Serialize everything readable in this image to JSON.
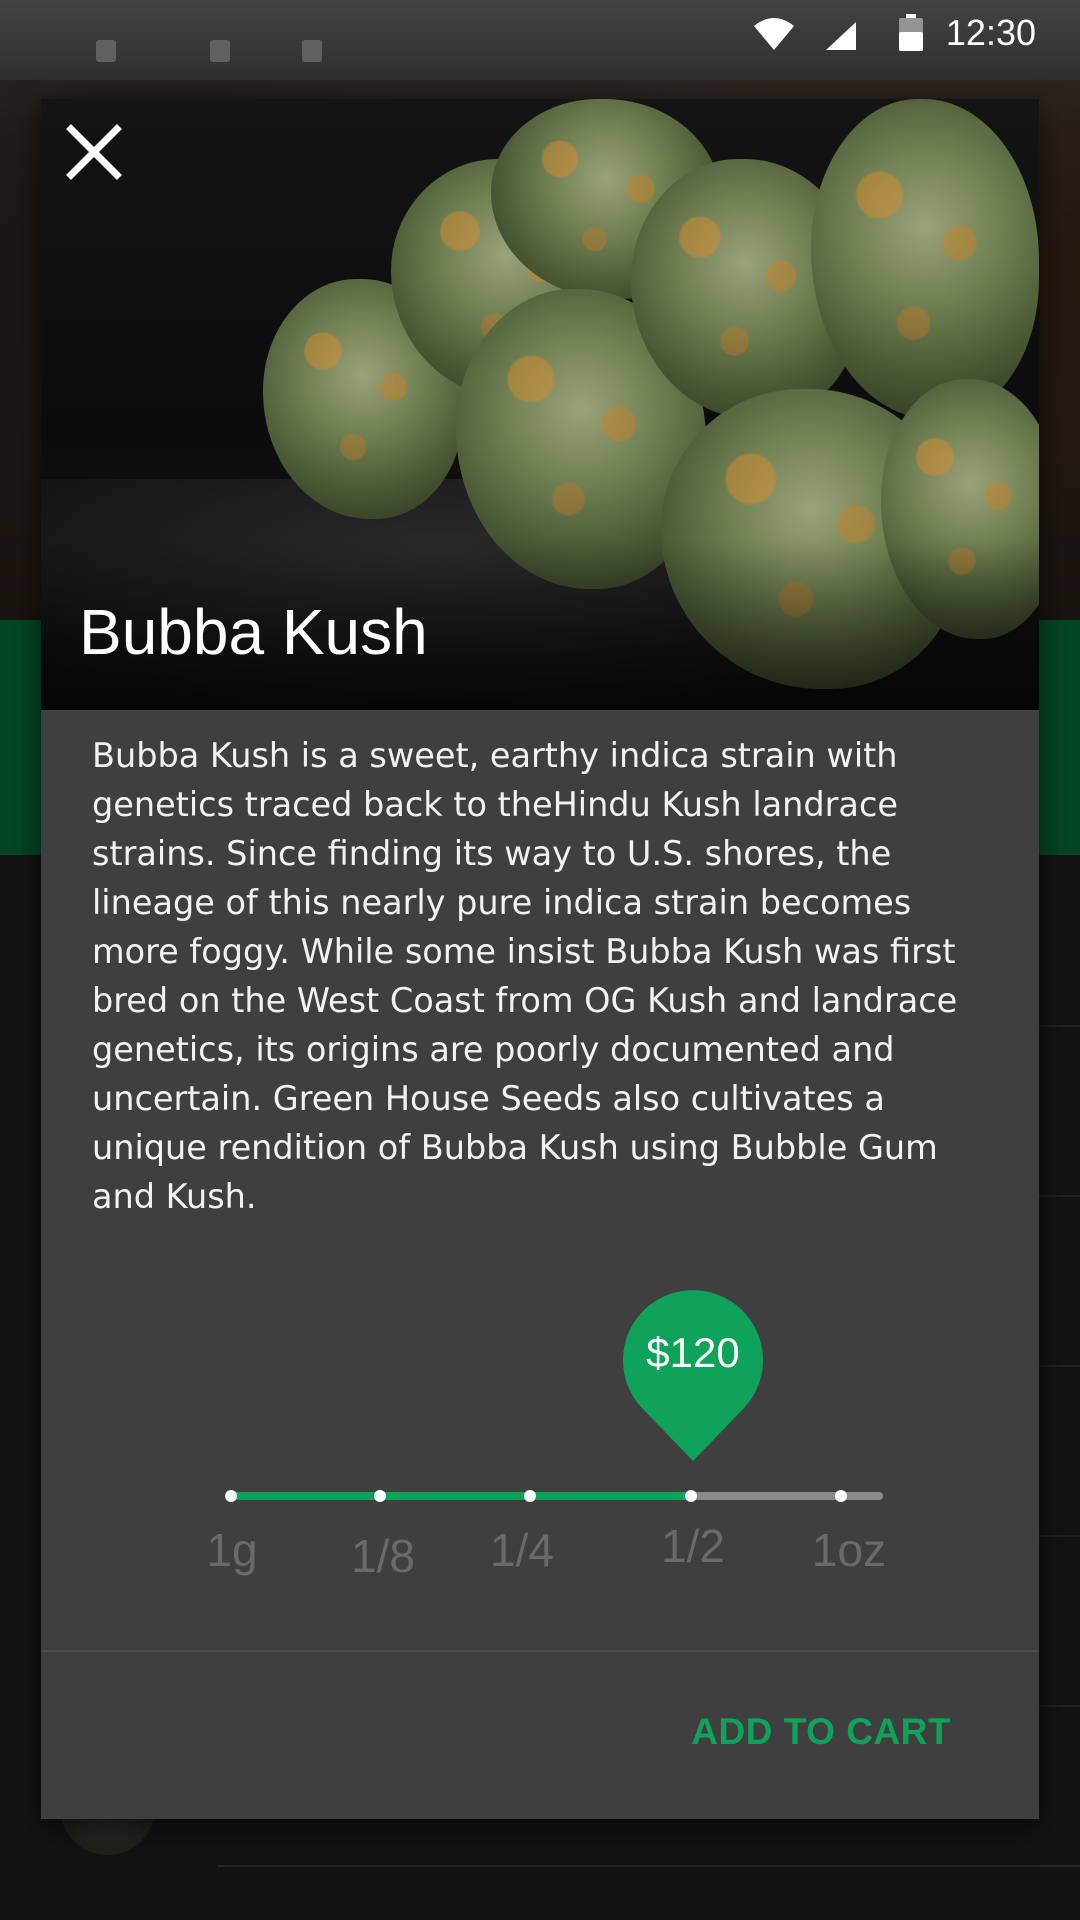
{
  "status_bar": {
    "time": "12:30",
    "icons": [
      "wifi-icon",
      "signal-icon",
      "battery-icon"
    ]
  },
  "dialog": {
    "close_icon": "close-icon",
    "product_name": "Bubba Kush",
    "description": "Bubba Kush is a sweet, earthy indica strain with genetics traced back to theHindu Kush landrace strains. Since finding its way to U.S. shores, the lineage of this nearly pure indica strain becomes more foggy. While some insist Bubba Kush was first bred on the West Coast from OG Kush and landrace genetics, its origins are poorly documented and uncertain. Green House Seeds also cultivates a unique rendition of Bubba Kush using Bubble Gum and Kush.",
    "price": "$120",
    "weight_options": [
      "1g",
      "1/8",
      "1/4",
      "1/2",
      "1oz"
    ],
    "selected_weight": "1/2",
    "add_to_cart_label": "ADD TO CART"
  },
  "colors": {
    "accent": "#0fa25a",
    "dialog_bg": "#3f3f3f",
    "inactive_label": "#6a6a6a"
  }
}
